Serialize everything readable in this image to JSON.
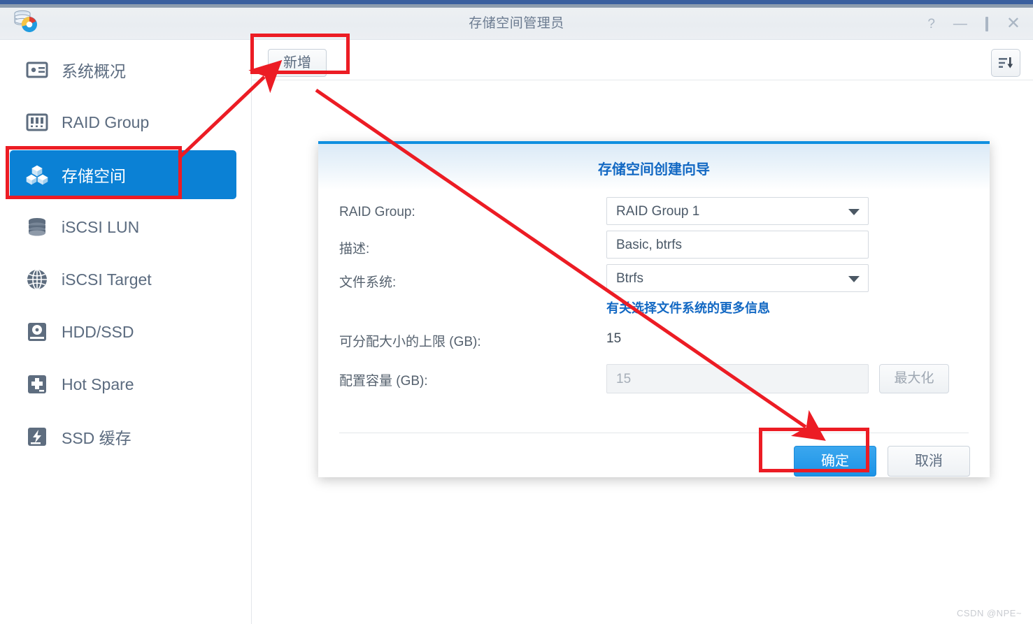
{
  "window": {
    "title": "存储空间管理员",
    "app_icon": "storage-manager-icon",
    "controls": {
      "help": "?",
      "minimize": "—",
      "maximize": "❐",
      "close": "✕"
    }
  },
  "sidebar": {
    "items": [
      {
        "label": "系统概况",
        "icon": "overview-card-icon",
        "active": false
      },
      {
        "label": "RAID Group",
        "icon": "raid-group-icon",
        "active": false
      },
      {
        "label": "存储空间",
        "icon": "storage-cubes-icon",
        "active": true
      },
      {
        "label": "iSCSI LUN",
        "icon": "disk-stack-icon",
        "active": false
      },
      {
        "label": "iSCSI Target",
        "icon": "globe-icon",
        "active": false
      },
      {
        "label": "HDD/SSD",
        "icon": "hard-disk-icon",
        "active": false
      },
      {
        "label": "Hot Spare",
        "icon": "plus-disk-icon",
        "active": false
      },
      {
        "label": "SSD 缓存",
        "icon": "ssd-bolt-icon",
        "active": false
      }
    ]
  },
  "toolbar": {
    "add_label": "新增",
    "sort_icon": "sort-descending-icon"
  },
  "dialog": {
    "title": "存储空间创建向导",
    "fields": [
      {
        "label": "RAID Group:",
        "value": "RAID Group 1",
        "type": "select",
        "disabled": false
      },
      {
        "label": "描述:",
        "value": "Basic, btrfs",
        "type": "text",
        "disabled": false
      },
      {
        "label": "文件系统:",
        "value": "Btrfs",
        "type": "select",
        "disabled": false
      }
    ],
    "fs_info_link": "有关选择文件系统的更多信息",
    "max_size": {
      "label": "可分配大小的上限 (GB):",
      "value": "15"
    },
    "capacity": {
      "label": "配置容量 (GB):",
      "value": "15",
      "maximize_label": "最大化"
    },
    "buttons": {
      "ok": "确定",
      "cancel": "取消"
    }
  },
  "annotations": {
    "watermark": "CSDN @NPE~",
    "highlight_color": "#ec1c24"
  },
  "colors": {
    "accent_blue": "#0b81d5",
    "title_blue": "#1268c3",
    "dialog_top_border": "#0f8fe0",
    "annotation_red": "#ec1c24"
  }
}
